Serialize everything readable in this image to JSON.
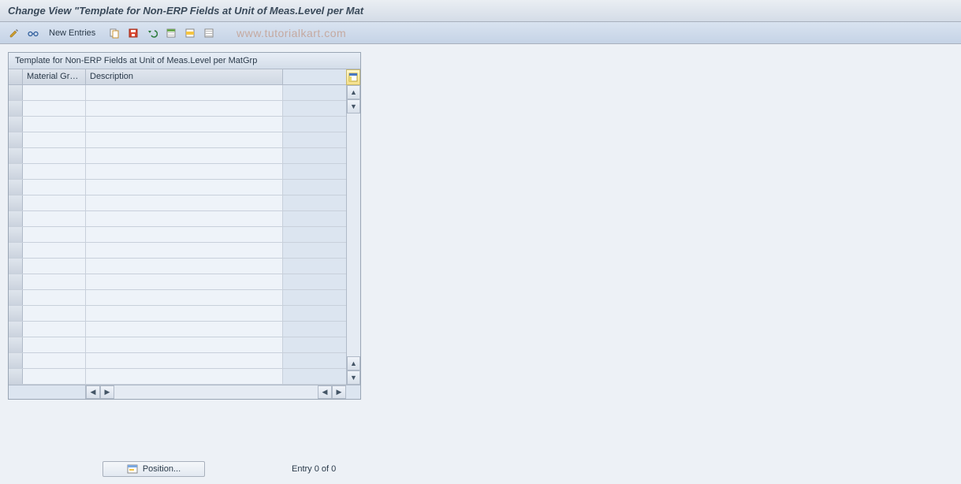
{
  "header": {
    "title": "Change View \"Template for Non-ERP Fields at Unit of Meas.Level per Mat"
  },
  "toolbar": {
    "icons": {
      "edit": "edit-icon",
      "glasses": "glasses-icon",
      "copy": "copy-icon",
      "save": "save-icon",
      "undo": "undo-icon",
      "grid1": "select-all-icon",
      "grid2": "select-block-icon",
      "grid3": "deselect-icon"
    },
    "new_entries_label": "New Entries"
  },
  "panel": {
    "title": "Template for Non-ERP Fields at Unit of Meas.Level per MatGrp",
    "columns": {
      "material_group": "Material Gro...",
      "description": "Description"
    },
    "rows": []
  },
  "watermark": "www.tutorialkart.com",
  "status": {
    "position_label": "Position...",
    "entry_text": "Entry 0 of 0"
  },
  "scroll": {
    "up": "▲",
    "down": "▼",
    "left": "◀",
    "right": "▶"
  }
}
